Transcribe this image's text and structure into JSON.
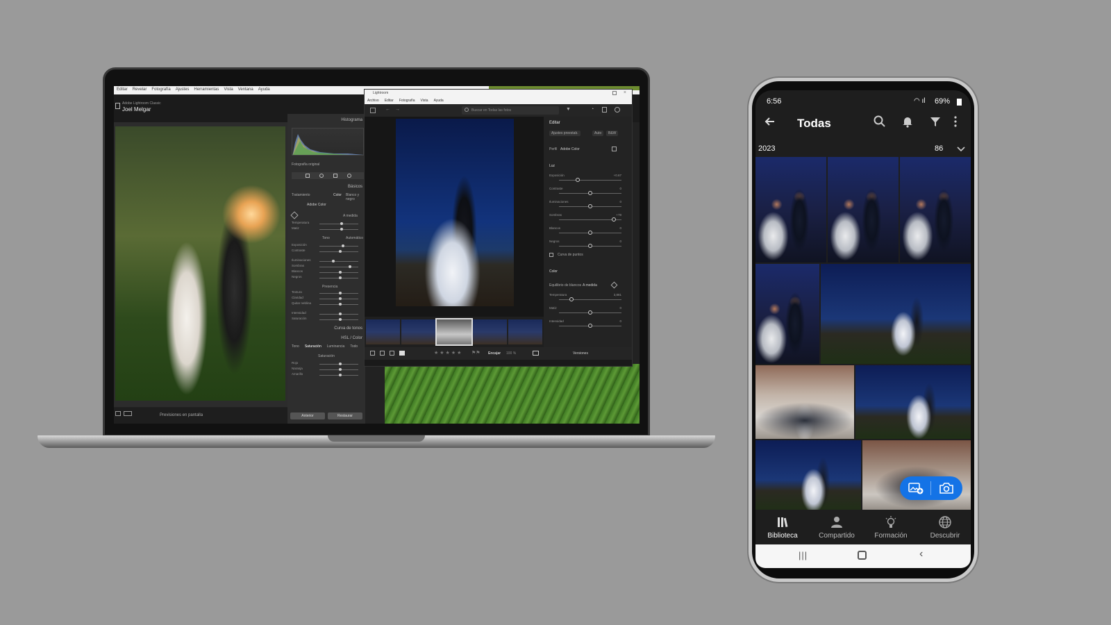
{
  "laptop": {
    "classic": {
      "menu": [
        "Editar",
        "Revelar",
        "Fotografía",
        "Ajustes",
        "Herramientas",
        "Vista",
        "Ventana",
        "Ayuda"
      ],
      "identity_top": "Adobe Lightroom Classic",
      "identity_name": "Joel Melgar",
      "panel": {
        "histogram": "Histograma",
        "original_photo": "Fotografía original",
        "basic": "Básicos",
        "treatment": "Tratamiento",
        "treatment_color": "Color",
        "treatment_bw": "Blanco y negro",
        "profile": "Adobe Color",
        "wb_value": "A medida",
        "tone": "Tono",
        "auto": "Automático",
        "presence": "Presencia",
        "tone_curve": "Curva de tonos",
        "hsl": "HSL / Color",
        "hsl_tabs": [
          "Tono",
          "Saturación",
          "Luminancia",
          "Todo"
        ],
        "hsl_sub": "Saturación",
        "sliders": [
          "Temperatura",
          "Matiz",
          "Exposición",
          "Contraste",
          "Iluminaciones",
          "Sombras",
          "Blancos",
          "Negros",
          "Textura",
          "Claridad",
          "Quitar neblina",
          "Intensidad",
          "Saturación",
          "Rojo",
          "Naranja",
          "Amarillo"
        ],
        "btn_previous": "Anterior",
        "btn_reset": "Restaurar"
      },
      "bottom_label": "Previsiones en pantalla"
    },
    "modern": {
      "title": "Lightroom",
      "menu": [
        "Archivo",
        "Editar",
        "Fotografía",
        "Vista",
        "Ayuda"
      ],
      "search_placeholder": "Buscar en Todas las fotos",
      "edit": {
        "heading": "Editar",
        "preset": "Ajustes preestab.",
        "auto": "Auto",
        "bw": "B&W",
        "profile_label": "Perfil",
        "profile_value": "Adobe Color",
        "light": "Luz",
        "light_sliders": [
          {
            "label": "Exposición",
            "value": "+0.67",
            "pos": 0.3
          },
          {
            "label": "Contraste",
            "value": "0",
            "pos": 0.5
          },
          {
            "label": "Iluminaciones",
            "value": "0",
            "pos": 0.5
          },
          {
            "label": "Sombras",
            "value": "+78",
            "pos": 0.88
          },
          {
            "label": "Blancos",
            "value": "0",
            "pos": 0.5
          },
          {
            "label": "Negros",
            "value": "0",
            "pos": 0.5
          }
        ],
        "point_curve": "Curva de puntos",
        "color": "Color",
        "wb_label": "Equilibrio de blancos",
        "wb_value": "A medida",
        "color_sliders": [
          {
            "label": "Temperatura",
            "value": "3,881",
            "pos": 0.2
          },
          {
            "label": "Matiz",
            "value": "0",
            "pos": 0.5
          },
          {
            "label": "Intensidad",
            "value": "0",
            "pos": 0.5
          }
        ]
      },
      "bottom": {
        "fit": "Encajar",
        "zoom": "100 %",
        "versions": "Versiones"
      }
    }
  },
  "phone": {
    "status": {
      "time": "6:56",
      "battery": "69%"
    },
    "title": "Todas",
    "year": "2023",
    "count": "86",
    "nav": [
      {
        "label": "Biblioteca",
        "icon": "library-icon",
        "active": true
      },
      {
        "label": "Compartido",
        "icon": "shared-people-icon",
        "active": false
      },
      {
        "label": "Formación",
        "icon": "lightbulb-icon",
        "active": false
      },
      {
        "label": "Descubrir",
        "icon": "globe-icon",
        "active": false
      }
    ]
  },
  "colors": {
    "background": "#9a9a9a",
    "accent_blue": "#1473e6",
    "phone_ui": "#1e1e1e"
  }
}
